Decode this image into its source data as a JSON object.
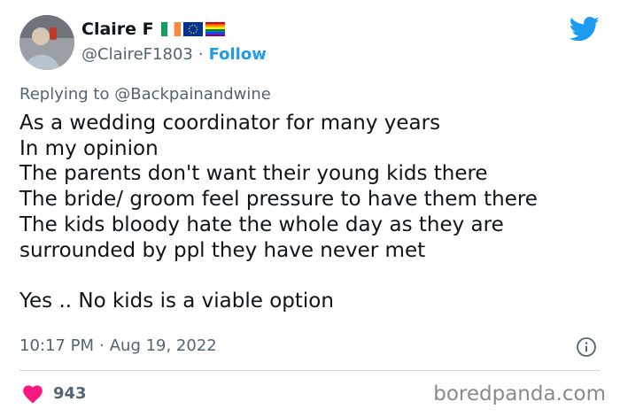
{
  "author": {
    "name": "Claire F",
    "handle": "@ClaireF1803",
    "separator": "·",
    "follow_label": "Follow"
  },
  "reply": {
    "prefix": "Replying to",
    "mention": "@Backpainandwine"
  },
  "tweet": {
    "lines": [
      "As a wedding coordinator for many years",
      "In my opinion",
      "The parents don't want their young kids there",
      "The bride/ groom feel pressure to have them there",
      "The kids bloody hate the whole day as they are",
      "surrounded by ppl they have never met",
      "",
      "Yes .. No kids is a viable option"
    ]
  },
  "meta": {
    "time": "10:17 PM",
    "separator": "·",
    "date": "Aug 19, 2022"
  },
  "engagement": {
    "likes": "943"
  },
  "watermark": "boredpanda.com",
  "colors": {
    "accent": "#1d9bf0",
    "heart": "#f91880",
    "secondary_text": "#536471"
  },
  "icons": [
    "twitter-bird-icon",
    "info-icon",
    "heart-icon"
  ]
}
